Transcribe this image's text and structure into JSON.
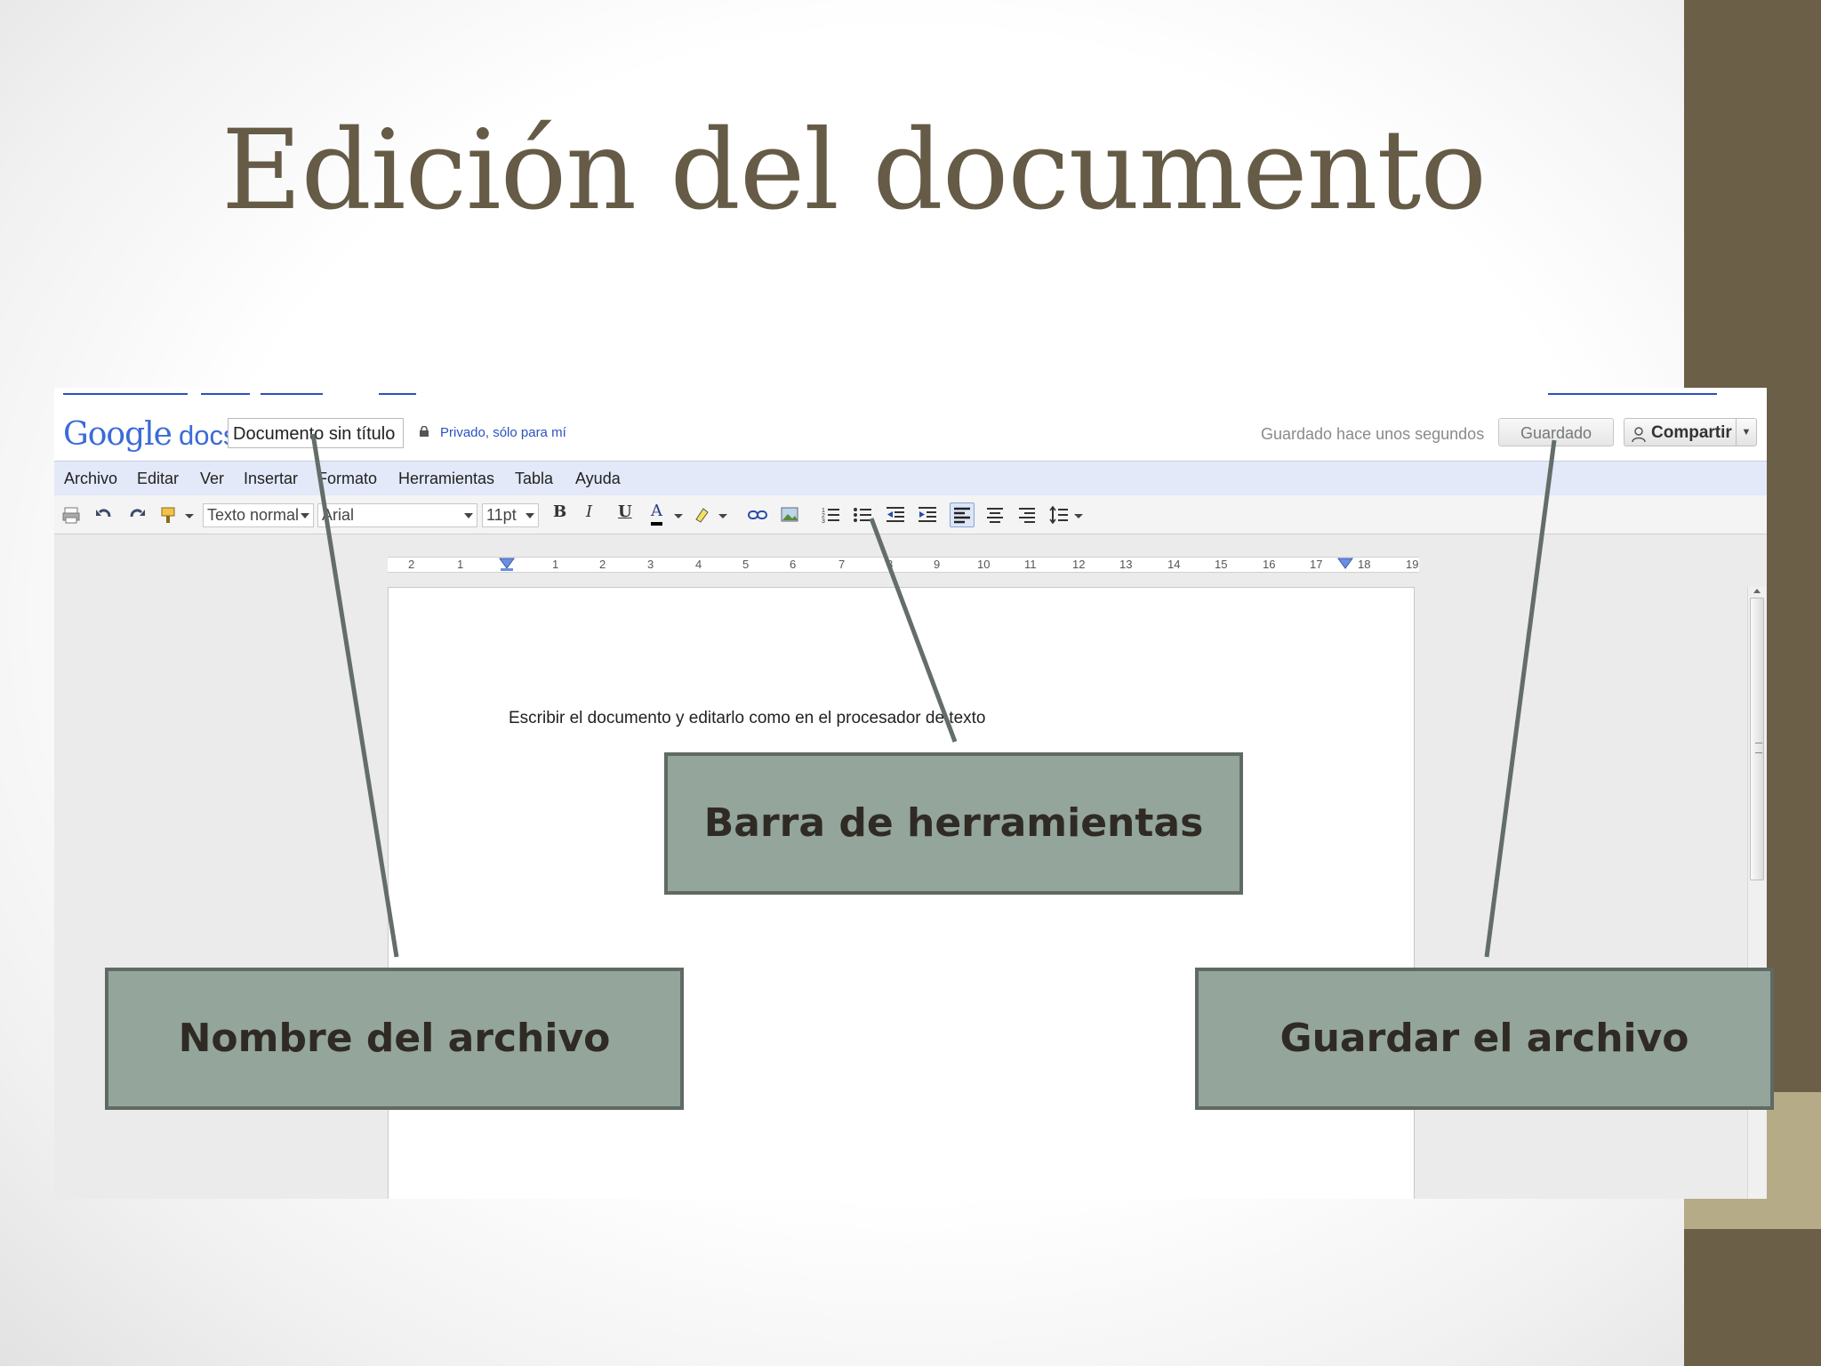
{
  "slide": {
    "title": "Edición del documento"
  },
  "header": {
    "logo_google": "Google",
    "logo_docs": "docs",
    "doc_name": "Documento sin título",
    "privacy": "Privado, sólo para mí",
    "saved_status": "Guardado hace unos segundos",
    "save_button": "Guardado",
    "share_button": "Compartir"
  },
  "menu": [
    "Archivo",
    "Editar",
    "Ver",
    "Insertar",
    "Formato",
    "Herramientas",
    "Tabla",
    "Ayuda"
  ],
  "toolbar": {
    "style_select": "Texto normal",
    "font_select": "Arial",
    "size_select": "11pt",
    "bold": "B",
    "italic": "I",
    "underline": "U",
    "text_color": "A"
  },
  "ruler": [
    "2",
    "1",
    "1",
    "2",
    "3",
    "4",
    "5",
    "6",
    "7",
    "8",
    "9",
    "10",
    "11",
    "12",
    "13",
    "14",
    "15",
    "16",
    "17",
    "18",
    "19"
  ],
  "document": {
    "body_text": "Escribir el documento y editarlo como en el procesador de texto"
  },
  "callouts": {
    "toolbar": "Barra de herramientas",
    "filename": "Nombre del archivo",
    "save": "Guardar el archivo"
  },
  "colors": {
    "title": "#655b46",
    "side_bar": "#6b5f48",
    "side_accent": "#b5ab86",
    "callout_fill": "#94a59b",
    "callout_border": "#5f6a64",
    "leader_line": "#646e69"
  }
}
